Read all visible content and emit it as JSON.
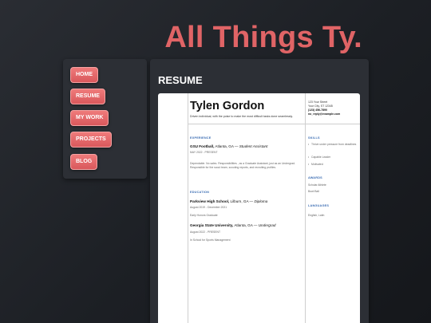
{
  "site": {
    "title": "All Things Ty."
  },
  "nav": {
    "items": [
      {
        "label": "HOME"
      },
      {
        "label": "RESUME"
      },
      {
        "label": "MY WORK"
      },
      {
        "label": "PROJECTS"
      },
      {
        "label": "BLOG"
      }
    ]
  },
  "main": {
    "heading": "RESUME"
  },
  "resume": {
    "name": "Tylen Gordon",
    "summary": "Driven individual, with the poise to make the most difficult tasks done seamlessly.",
    "contact": {
      "street": "123 Your Street",
      "city": "Your City, ST 12345",
      "phone": "(123) 456-7890",
      "email": "no_reply@example.com"
    },
    "experience": {
      "heading": "EXPERIENCE",
      "jobs": [
        {
          "org": "GSU Football,",
          "place": " Atlanta, GA — ",
          "role": "Student Assistant",
          "dates": "MAY 2022 - PRESENT",
          "description": "Dependable. No sales. Responsibilities , as a Graduate Assistant, just as an Undergrad. Responsible  for the scout team, scouting reports, and recruiting profiles."
        }
      ]
    },
    "education": {
      "heading": "EDUCATION",
      "schools": [
        {
          "org": "Parkview High School,",
          "place": " Lilburn, GA — ",
          "role": "Diploma",
          "dates": "August 2019 - December 2021",
          "note": "Early Honors Graduate"
        },
        {
          "org": "Georgia State University,",
          "place": " Atlanta, GA — ",
          "role": "Undergrad",
          "dates": "August 2022 - PRESENT",
          "note": "In School for Sports Management"
        }
      ]
    },
    "skills": {
      "heading": "SKILLS",
      "items": [
        "Thrive under pressure from deadlines",
        "Capable  Leader",
        "Motivated"
      ]
    },
    "awards": {
      "heading": "AWARDS",
      "items": [
        "Scholar Athlete",
        "Bowl Ball"
      ]
    },
    "languages": {
      "heading": "LANGUAGES",
      "text": "English, Latin"
    }
  }
}
